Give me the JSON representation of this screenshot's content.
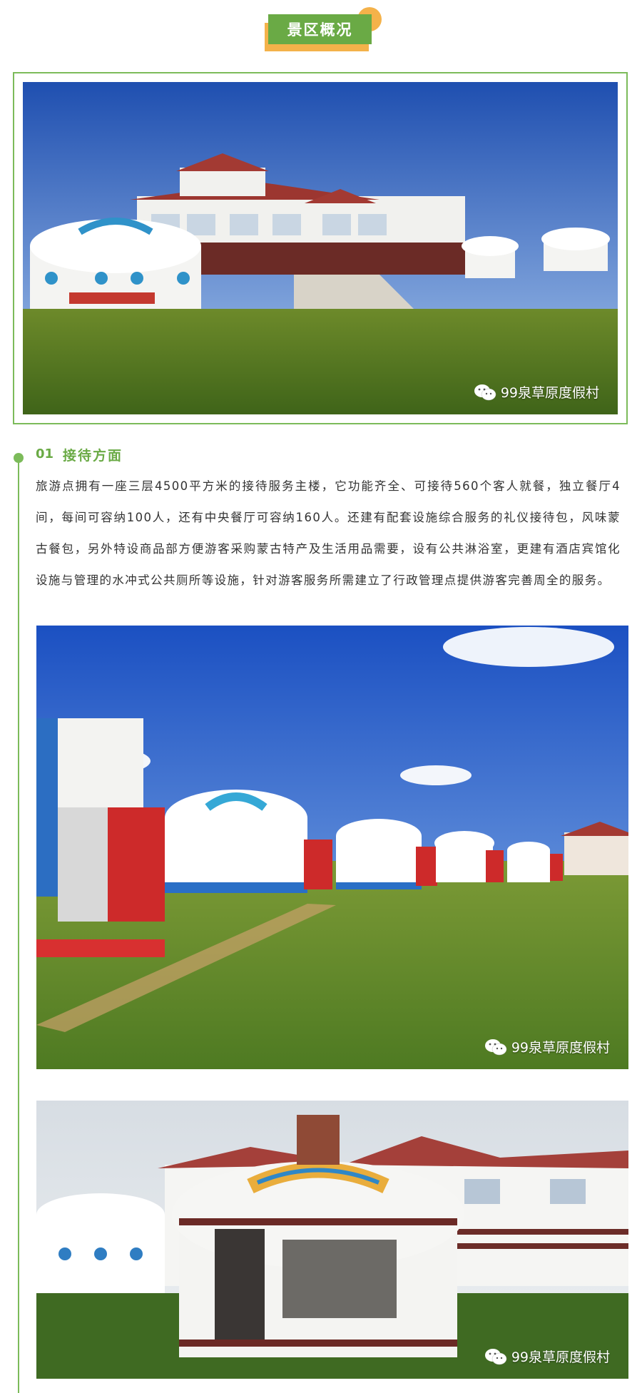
{
  "header": {
    "tag_label": "景区概况"
  },
  "watermark": {
    "text": "99泉草原度假村",
    "icon": "wechat-icon"
  },
  "section": {
    "number": "01",
    "title": "接待方面",
    "paragraph": "旅游点拥有一座三层4500平方米的接待服务主楼，它功能齐全、可接待560个客人就餐，独立餐厅4间，每间可容纳100人，还有中央餐厅可容纳160人。还建有配套设施综合服务的礼仪接待包，风味蒙古餐包，另外特设商品部方便游客采购蒙古特产及生活用品需要，设有公共淋浴室，更建有酒店宾馆化设施与管理的水冲式公共厕所等设施，针对游客服务所需建立了行政管理点提供游客完善周全的服务。"
  },
  "colors": {
    "accent_green": "#6aaa45",
    "accent_orange": "#f4b24a"
  }
}
